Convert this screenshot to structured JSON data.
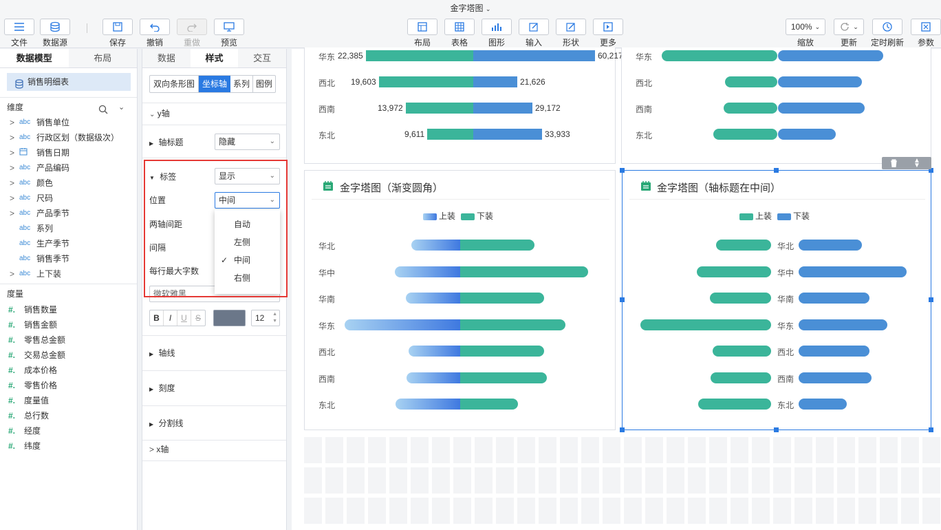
{
  "window": {
    "title": "金字塔图"
  },
  "toolbar": {
    "file": "文件",
    "datasource": "数据源",
    "save": "保存",
    "undo": "撤销",
    "redo": "重做",
    "preview": "预览",
    "layout": "布局",
    "table": "表格",
    "chart": "图形",
    "input": "输入",
    "shape": "形状",
    "more": "更多",
    "zoom_value": "100%",
    "zoom": "缩放",
    "refresh": "更新",
    "timed_refresh": "定时刷新",
    "params": "参数"
  },
  "left_panel": {
    "tabs": [
      "数据模型",
      "布局"
    ],
    "dataset": "销售明细表",
    "dimensions_label": "维度",
    "dimensions": [
      {
        "type": "abc",
        "label": "销售单位",
        "expand": true
      },
      {
        "type": "abc",
        "label": "行政区划（数据级次）",
        "expand": true
      },
      {
        "type": "date",
        "label": "销售日期",
        "expand": true
      },
      {
        "type": "abc",
        "label": "产品编码",
        "expand": true
      },
      {
        "type": "abc",
        "label": "颜色",
        "expand": true
      },
      {
        "type": "abc",
        "label": "尺码",
        "expand": true
      },
      {
        "type": "abc",
        "label": "产品季节",
        "expand": true
      },
      {
        "type": "abc",
        "label": "系列",
        "expand": false
      },
      {
        "type": "abc",
        "label": "生产季节",
        "expand": false
      },
      {
        "type": "abc",
        "label": "销售季节",
        "expand": false
      },
      {
        "type": "abc",
        "label": "上下装",
        "expand": true
      }
    ],
    "measures_label": "度量",
    "measures": [
      "销售数量",
      "销售金额",
      "零售总金额",
      "交易总金额",
      "成本价格",
      "零售价格",
      "度量值",
      "总行数",
      "经度",
      "纬度"
    ]
  },
  "prop_panel": {
    "tabs": [
      "数据",
      "样式",
      "交互"
    ],
    "subtabs": [
      "双向条形图",
      "坐标轴",
      "系列",
      "图例"
    ],
    "y_axis": "y轴",
    "axis_title_label": "轴标题",
    "axis_title_value": "隐藏",
    "label_label": "标签",
    "label_value": "显示",
    "position_label": "位置",
    "position_value": "中间",
    "gap_label": "两轴间距",
    "interval_label": "间隔",
    "maxchars_label": "每行最大字数",
    "font_value": "微软雅黑",
    "font_size": "12",
    "font_buttons": [
      "B",
      "I",
      "U",
      "S"
    ],
    "font_color": "#6b7789",
    "dropdown_options": [
      "自动",
      "左侧",
      "中间",
      "右侧"
    ],
    "dropdown_selected": "中间",
    "axis_line": "轴线",
    "ticks": "刻度",
    "split_line": "分割线",
    "x_axis": "x轴"
  },
  "colors": {
    "green": "#3bb59a",
    "blue": "#4a8fd6",
    "accent": "#2a7ae2",
    "highlight": "#e53935"
  },
  "charts": {
    "top_left": {
      "categories": [
        "华东",
        "西北",
        "西南",
        "东北"
      ],
      "left_values": [
        "22,385",
        "19,603",
        "13,972",
        "9,611"
      ],
      "right_values": [
        "60,217",
        "21,626",
        "29,172",
        "33,933"
      ]
    },
    "top_right": {
      "categories": [
        "华东",
        "西北",
        "西南",
        "东北"
      ]
    },
    "bottom_left": {
      "title": "金字塔图（渐变圆角）",
      "legend": [
        "上装",
        "下装"
      ],
      "categories": [
        "华北",
        "华中",
        "华南",
        "华东",
        "西北",
        "西南",
        "东北"
      ]
    },
    "bottom_right": {
      "title": "金字塔图（轴标题在中间）",
      "legend": [
        "上装",
        "下装"
      ],
      "categories": [
        "华北",
        "华中",
        "华南",
        "华东",
        "西北",
        "西南",
        "东北"
      ]
    }
  }
}
